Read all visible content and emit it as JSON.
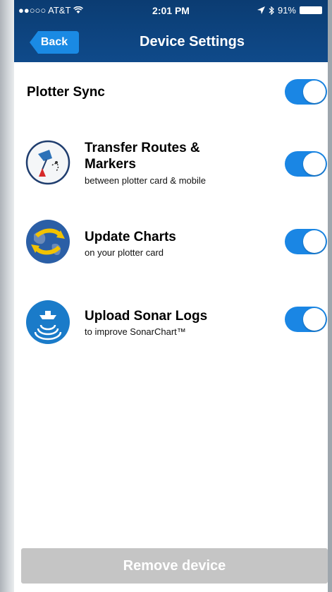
{
  "status_bar": {
    "carrier": "●●○○○ AT&T",
    "time": "2:01 PM",
    "battery": "91%"
  },
  "navbar": {
    "back_label": "Back",
    "title": "Device Settings"
  },
  "plotter_sync": {
    "label": "Plotter Sync",
    "enabled": true
  },
  "features": [
    {
      "title": "Transfer Routes & Markers",
      "subtitle": "between plotter card & mobile",
      "icon": "route-marker-icon",
      "enabled": true
    },
    {
      "title": "Update Charts",
      "subtitle": "on your plotter card",
      "icon": "globe-sync-icon",
      "enabled": true
    },
    {
      "title": "Upload Sonar Logs",
      "subtitle": "to improve SonarChart™",
      "icon": "sonar-boat-icon",
      "enabled": true
    }
  ],
  "footer": {
    "remove_label": "Remove device"
  },
  "colors": {
    "navbar": "#0f4a8a",
    "accent": "#1a86e4",
    "disabled_button": "#c5c5c5"
  }
}
